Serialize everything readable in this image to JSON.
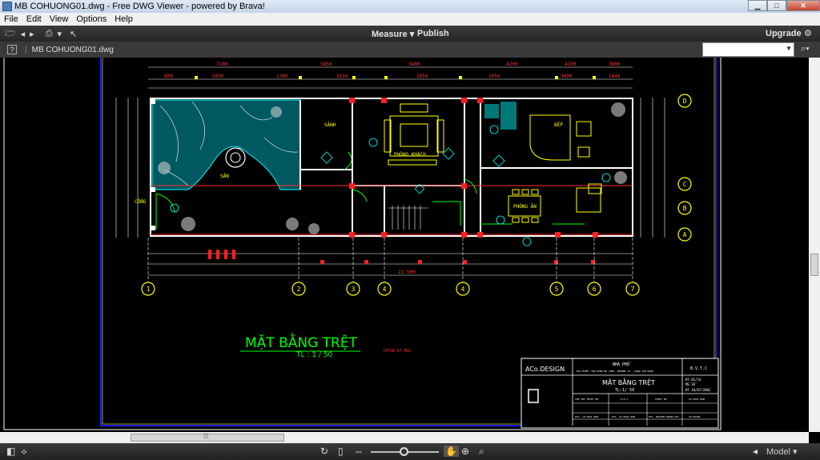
{
  "window": {
    "title": "MB COHUONG01.dwg - Free DWG Viewer - powered by Brava!",
    "btn_min": "▁",
    "btn_max": "□",
    "btn_close": "✕"
  },
  "menu": [
    "File",
    "Edit",
    "View",
    "Options",
    "Help"
  ],
  "toolbar": {
    "measure": "Measure",
    "publish": "Publish",
    "upgrade": "Upgrade",
    "dropdown_glyph": "▾"
  },
  "tab": {
    "help": "?",
    "file_name": "MB COHUONG01.dwg"
  },
  "drawing": {
    "title": "MẶT BẰNG TRỆT",
    "scale": "TL : 1 / 50",
    "note": "(DTSD 87 M2)",
    "grid_markers": [
      "1",
      "2",
      "3",
      "4",
      "5",
      "6",
      "7",
      "A",
      "B",
      "C",
      "D"
    ],
    "rooms": {
      "living": "PHÒNG KHÁCH",
      "dining": "PHÒNG ĂN",
      "yard": "SÂN",
      "kitchen": "BẾP",
      "porch": "SẢNH",
      "gate": "CỔNG"
    },
    "overall_dim": "22.500",
    "title_block": {
      "company": "ACo.DESIGN",
      "project": "NHÀ PHỐ",
      "address": "ĐỊA ĐIỂM: 366 ĐINH BỘ LĨNH, PHƯỜNG 15 - QUẬN TÂN BÌNH",
      "stage": "B.V.T.C",
      "sheet_title": "MẶT BẰNG TRỆT",
      "sheet_scale": "TL:1/ 50",
      "sheet_no": "KT-01/14",
      "code": "MS SỐ",
      "date": "HT 10/07/2002",
      "col1": "CHỦ TRÌ THIẾT KẾ",
      "col2": "Q.H.T",
      "col3": "THIẾT KẾ",
      "col4": "LÊ HOÀI NAM",
      "row1": "KTS. LÊ HOÀI NAM",
      "row2": "KTS. LÊ HOÀI NAM",
      "row3": "KTS. NGUYỄN HOÀNG DUY",
      "row4": "VŨ HOÀNG"
    }
  },
  "status": {
    "model_label": "Model",
    "model_dd": "▾"
  },
  "colors": {
    "cyan": "#00ffff",
    "yellow": "#ffff00",
    "red": "#ff2020",
    "green": "#00ff00",
    "white": "#ffffff",
    "blue_frame": "#0000ff"
  }
}
